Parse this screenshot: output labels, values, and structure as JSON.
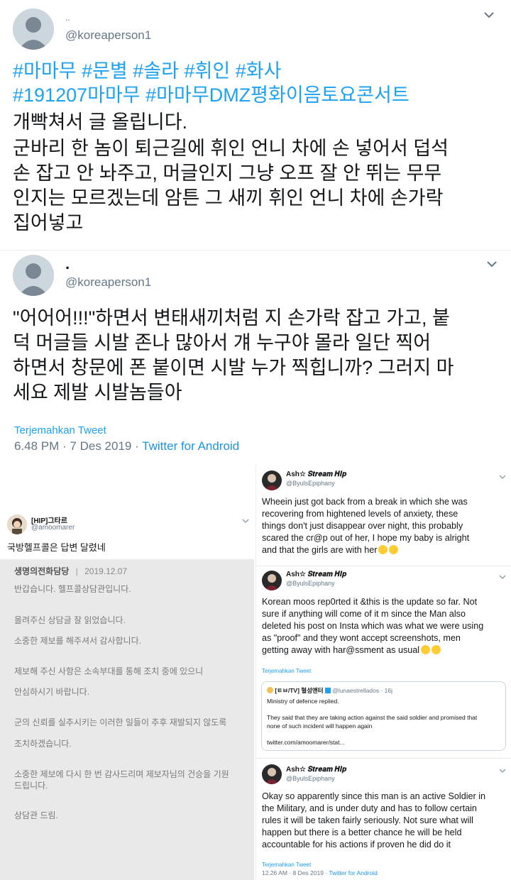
{
  "tweet1": {
    "display_name": "..",
    "handle": "@koreaperson1",
    "hashtag_line1": [
      "#마마무",
      "#문별",
      "#솔라",
      "#휘인",
      "#화사"
    ],
    "hashtag_line2": [
      "#191207마마무",
      "#마마무DMZ평화이음토요콘서트"
    ],
    "body_lines": [
      "개빡쳐서 글 올립니다.",
      "군바리 한 놈이 퇴근길에 휘인 언니 차에 손 넣어서 덥석",
      "손 잡고 안 놔주고, 머글인지 그냥 오프 잘 안 뛰는 무무",
      "인지는 모르겠는데 암튼 그 새끼 휘인 언니 차에 손가락",
      "집어넣고"
    ]
  },
  "tweet2": {
    "display_name": ".",
    "handle": "@koreaperson1",
    "body_lines": [
      "\"어어어!!!\"하면서 변태새끼처럼 지 손가락 잡고 가고, 붙",
      "덕 머글들 시발 존나 많아서 걔 누구야 몰라 일단 찍어",
      "하면서 창문에 폰 붙이면 시발 누가 찍힙니까? 그러지 마",
      "세요 제발 시발놈들아"
    ],
    "translate": "Terjemahkan Tweet",
    "time": "6.48 PM · 7 Des 2019 · ",
    "client": "Twitter for Android"
  },
  "left_tweet": {
    "display_name": "[HIP]그타르",
    "handle": "@amoomarer",
    "text": "국방헬프콜은 답변 달렸네",
    "reply": {
      "sender": "생명의전화담당",
      "date": "2019.12.07",
      "lines": [
        "반갑습니다. 헬프콜상담관입니다.",
        "올려주신 상담글 잘 읽었습니다.",
        "소중한 제보를 해주셔서 감사합니다.",
        "제보해 주신 사항은 소속부대를 통해 조치 중에 있으니",
        "안심하시기 바랍니다.",
        "군의 신뢰를 실추시키는 이러한 일들이 추후 재발되지 않도록",
        "조치하겠습니다.",
        "소중한 제보에 다시 한 번 감사드리며 제보자님의 건승을 기원",
        "드립니다.",
        "상담관 드림."
      ]
    }
  },
  "right_tweets": [
    {
      "display_name": "Ash☆ 𝑺𝒕𝒓𝒆𝒂𝒎 𝑯𝒊𝒑",
      "handle": "@ByulsEpiphany",
      "lines": [
        "Wheein just got back from a break in which she was",
        "recovering from hightened levels of anxiety, these",
        "things don't just disappear over night, this probably",
        "scared the cr@p out of her, I hope my baby is alright",
        "and that the girls are with her"
      ]
    },
    {
      "display_name": "Ash☆ 𝑺𝒕𝒓𝒆𝒂𝒎 𝑯𝒊𝒑",
      "handle": "@ByulsEpiphany",
      "lines": [
        "Korean moos rep0rted it &this is the update so far. Not",
        "sure if anything will come of it m since the Man also",
        "deleted his post on Insta which was what we were using",
        "as \"proof\" and they wont accept screenshots, men",
        "getting away with har@ssment as usual"
      ],
      "translate": "Terjemahkan Tweet",
      "quote": {
        "name": "[ㅌㅂ/TV] 혈성앤터",
        "handle": "@lunaestrellados · 16j",
        "lines": [
          "Ministry of defence replied.",
          "They said that they are taking action against the said soldier and promised that",
          "none of such incident will happen again",
          "twitter.com/amoomarer/stat..."
        ]
      }
    },
    {
      "display_name": "Ash☆ 𝑺𝒕𝒓𝒆𝒂𝒎 𝑯𝒊𝒑",
      "handle": "@ByulsEpiphany",
      "lines": [
        "Okay so apparently since this man is an active Soldier in",
        "the Military, and is under duty and has to follow certain",
        "rules it will be taken fairly seriously. Not sure what will",
        "happen but there is a better chance he will be held",
        "accountable for his actions if proven he did do it"
      ],
      "translate": "Terjemahkan Tweet",
      "time": "12.26 AM · 8 Des 2019 · ",
      "client": "Twitter for Android"
    }
  ],
  "colors": {
    "link": "#1da1f2",
    "muted": "#657786",
    "border": "#e6ecf0"
  }
}
